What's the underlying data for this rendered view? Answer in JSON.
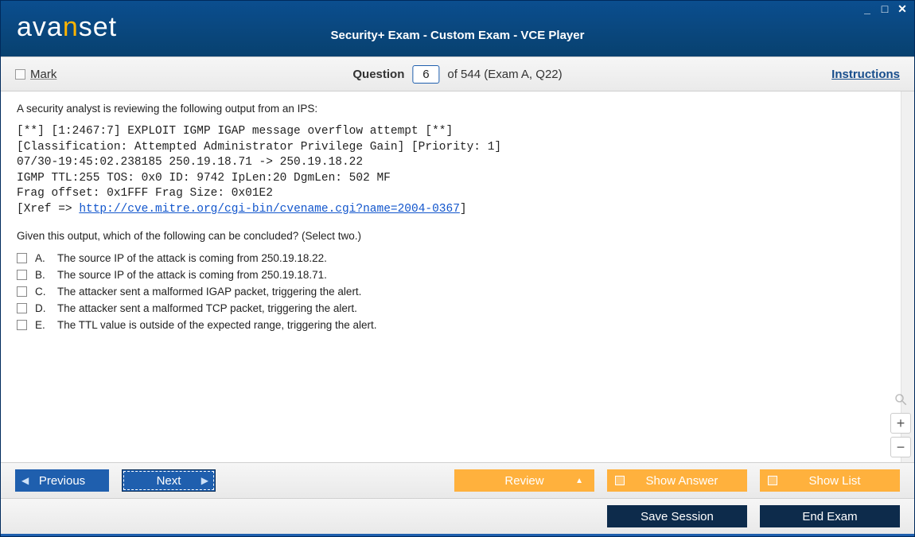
{
  "window": {
    "logo_prefix": "ava",
    "logo_accent": "n",
    "logo_suffix": "set",
    "title": "Security+ Exam - Custom Exam - VCE Player"
  },
  "toolbar": {
    "mark_label": "Mark",
    "question_label": "Question",
    "current_number": "6",
    "of_text": "of 544 (Exam A, Q22)",
    "instructions": "Instructions"
  },
  "question": {
    "intro": "A security analyst is reviewing the following output from an IPS:",
    "pre_lines": [
      "[**] [1:2467:7] EXPLOIT IGMP IGAP message overflow attempt [**]",
      "[Classification: Attempted Administrator Privilege Gain] [Priority: 1]",
      "07/30-19:45:02.238185 250.19.18.71 -> 250.19.18.22",
      "IGMP TTL:255 TOS: 0x0 ID: 9742 IpLen:20 DgmLen: 502 MF",
      "Frag offset: 0x1FFF Frag Size: 0x01E2"
    ],
    "xref_prefix": "[Xref => ",
    "xref_link": "http://cve.mitre.org/cgi-bin/cvename.cgi?name=2004-0367",
    "xref_suffix": "]",
    "prompt": "Given this output, which of the following can be concluded? (Select two.)",
    "choices": [
      {
        "letter": "A.",
        "text": "The source IP of the attack is coming from 250.19.18.22."
      },
      {
        "letter": "B.",
        "text": "The source IP of the attack is coming from 250.19.18.71."
      },
      {
        "letter": "C.",
        "text": "The attacker sent a malformed IGAP packet, triggering the alert."
      },
      {
        "letter": "D.",
        "text": "The attacker sent a malformed TCP packet, triggering the alert."
      },
      {
        "letter": "E.",
        "text": "The TTL value is outside of the expected range, triggering the alert."
      }
    ]
  },
  "nav": {
    "previous": "Previous",
    "next": "Next",
    "review": "Review",
    "show_answer": "Show Answer",
    "show_list": "Show List"
  },
  "footer": {
    "save_session": "Save Session",
    "end_exam": "End Exam"
  }
}
